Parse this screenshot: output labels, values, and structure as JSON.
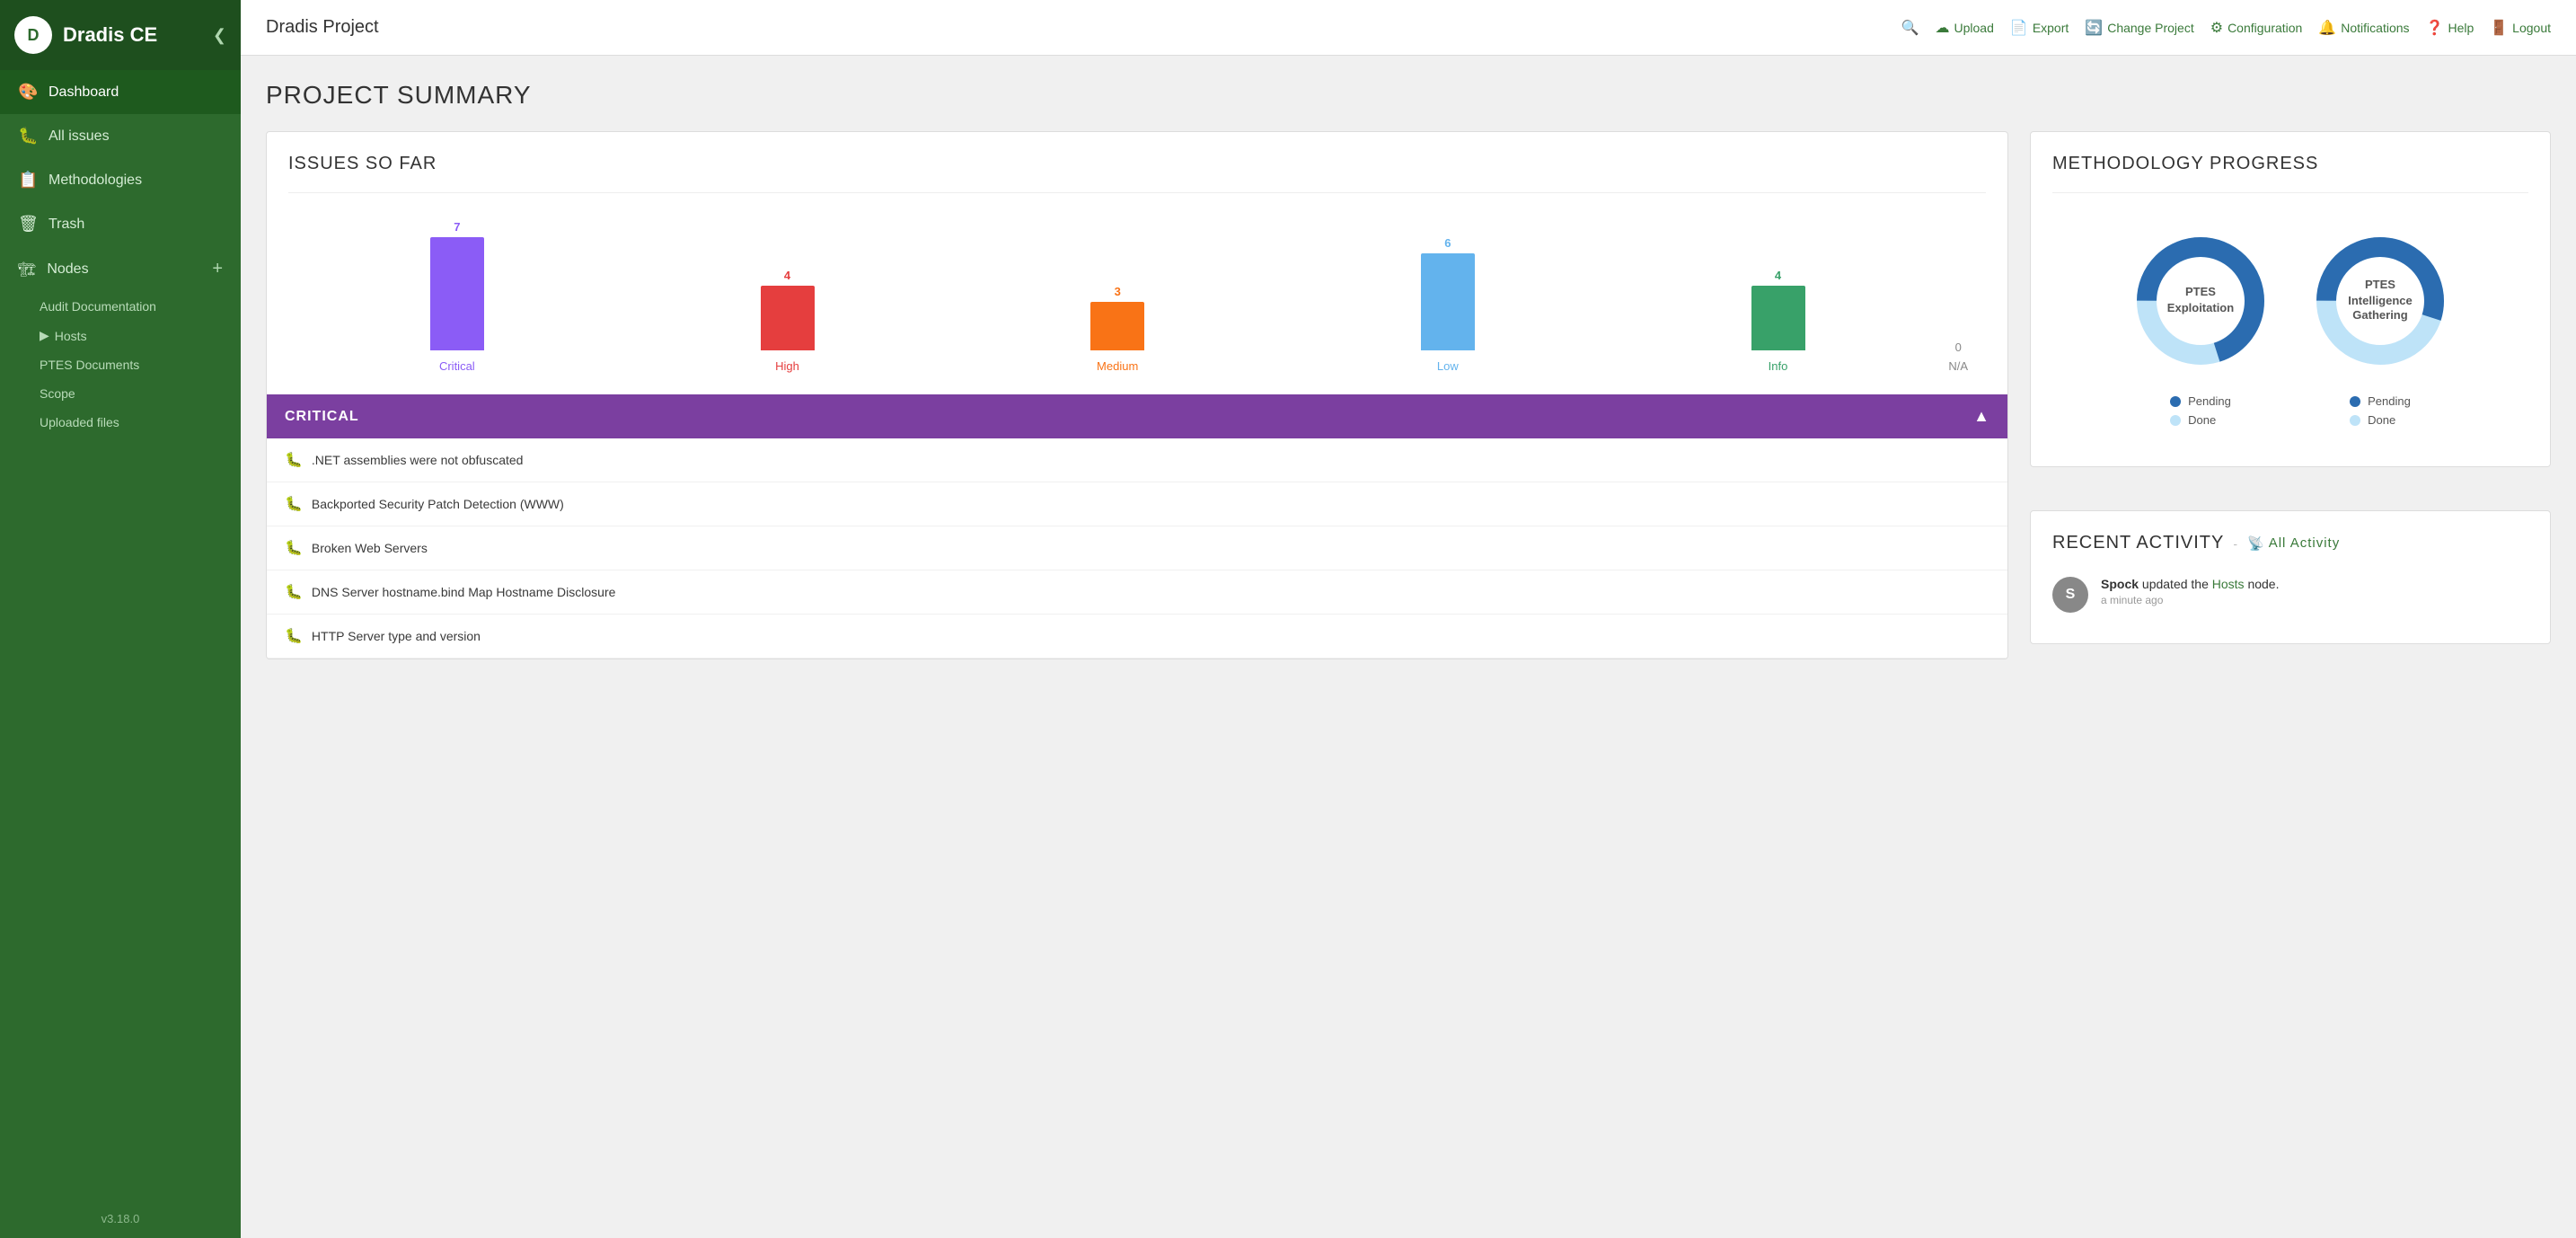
{
  "sidebar": {
    "logo_text": "D",
    "title": "Dradis CE",
    "collapse_icon": "❮",
    "nav_items": [
      {
        "id": "dashboard",
        "label": "Dashboard",
        "icon": "🎨",
        "active": true
      },
      {
        "id": "all-issues",
        "label": "All issues",
        "icon": "🐛"
      },
      {
        "id": "methodologies",
        "label": "Methodologies",
        "icon": "📋"
      },
      {
        "id": "trash",
        "label": "Trash",
        "icon": "🗑"
      }
    ],
    "nodes_label": "Nodes",
    "nodes_add_icon": "+",
    "sub_items": [
      {
        "id": "audit-docs",
        "label": "Audit Documentation",
        "has_arrow": false
      },
      {
        "id": "hosts",
        "label": "Hosts",
        "has_arrow": true
      },
      {
        "id": "ptes-docs",
        "label": "PTES Documents",
        "has_arrow": false
      },
      {
        "id": "scope",
        "label": "Scope",
        "has_arrow": false
      },
      {
        "id": "uploaded-files",
        "label": "Uploaded files",
        "has_arrow": false
      }
    ],
    "version": "v3.18.0"
  },
  "topbar": {
    "title": "Dradis Project",
    "actions": [
      {
        "id": "search",
        "icon": "🔍",
        "label": ""
      },
      {
        "id": "upload",
        "icon": "☁",
        "label": "Upload"
      },
      {
        "id": "export",
        "icon": "📄",
        "label": "Export"
      },
      {
        "id": "change-project",
        "icon": "🔄",
        "label": "Change Project"
      },
      {
        "id": "configuration",
        "icon": "⚙",
        "label": "Configuration"
      },
      {
        "id": "notifications",
        "icon": "🔔",
        "label": "Notifications"
      },
      {
        "id": "help",
        "icon": "❓",
        "label": "Help"
      },
      {
        "id": "logout",
        "icon": "🚪",
        "label": "Logout"
      }
    ]
  },
  "page": {
    "heading": "PROJECT SUMMARY"
  },
  "issues_chart": {
    "heading": "ISSUES SO FAR",
    "bars": [
      {
        "id": "critical",
        "label": "Critical",
        "value": 7,
        "color": "#8b5cf6",
        "label_color": "#8b5cf6",
        "height_pct": 100
      },
      {
        "id": "high",
        "label": "High",
        "value": 4,
        "color": "#e53e3e",
        "label_color": "#e53e3e",
        "height_pct": 57
      },
      {
        "id": "medium",
        "label": "Medium",
        "value": 3,
        "color": "#f97316",
        "label_color": "#f97316",
        "height_pct": 43
      },
      {
        "id": "low",
        "label": "Low",
        "value": 6,
        "color": "#63b3ed",
        "label_color": "#63b3ed",
        "height_pct": 86
      },
      {
        "id": "info",
        "label": "Info",
        "value": 4,
        "color": "#38a169",
        "label_color": "#38a169",
        "height_pct": 57
      }
    ],
    "na_value": "0",
    "na_label": "N/A"
  },
  "critical_section": {
    "title": "CRITICAL",
    "toggle_icon": "▲",
    "issues": [
      {
        "id": "issue-1",
        "text": ".NET assemblies were not obfuscated"
      },
      {
        "id": "issue-2",
        "text": "Backported Security Patch Detection (WWW)"
      },
      {
        "id": "issue-3",
        "text": "Broken Web Servers"
      },
      {
        "id": "issue-4",
        "text": "DNS Server hostname.bind Map Hostname Disclosure"
      },
      {
        "id": "issue-5",
        "text": "HTTP Server type and version"
      }
    ]
  },
  "methodology": {
    "heading": "METHODOLOGY PROGRESS",
    "charts": [
      {
        "id": "ptes-exploitation",
        "label": "PTES\nExploitation",
        "label_line1": "PTES",
        "label_line2": "Exploitation",
        "pending_pct": 70,
        "done_pct": 30,
        "pending_color": "#2b6cb0",
        "done_color": "#bee3f8"
      },
      {
        "id": "ptes-intelligence",
        "label": "PTES\nIntelligence\nGathering",
        "label_line1": "PTES",
        "label_line2": "Intelligence",
        "label_line3": "Gathering",
        "pending_pct": 55,
        "done_pct": 45,
        "pending_color": "#2b6cb0",
        "done_color": "#bee3f8"
      }
    ],
    "legend": {
      "pending_label": "Pending",
      "done_label": "Done",
      "pending_color": "#2b6cb0",
      "done_color": "#bee3f8"
    }
  },
  "recent_activity": {
    "heading": "RECENT ACTIVITY",
    "all_activity_link": "All Activity",
    "rss_icon": "📡",
    "items": [
      {
        "id": "activity-1",
        "avatar_letter": "S",
        "avatar_bg": "#888",
        "user": "Spock",
        "action": "updated the",
        "target": "Hosts",
        "target_suffix": "node.",
        "time": "a minute ago"
      }
    ]
  }
}
